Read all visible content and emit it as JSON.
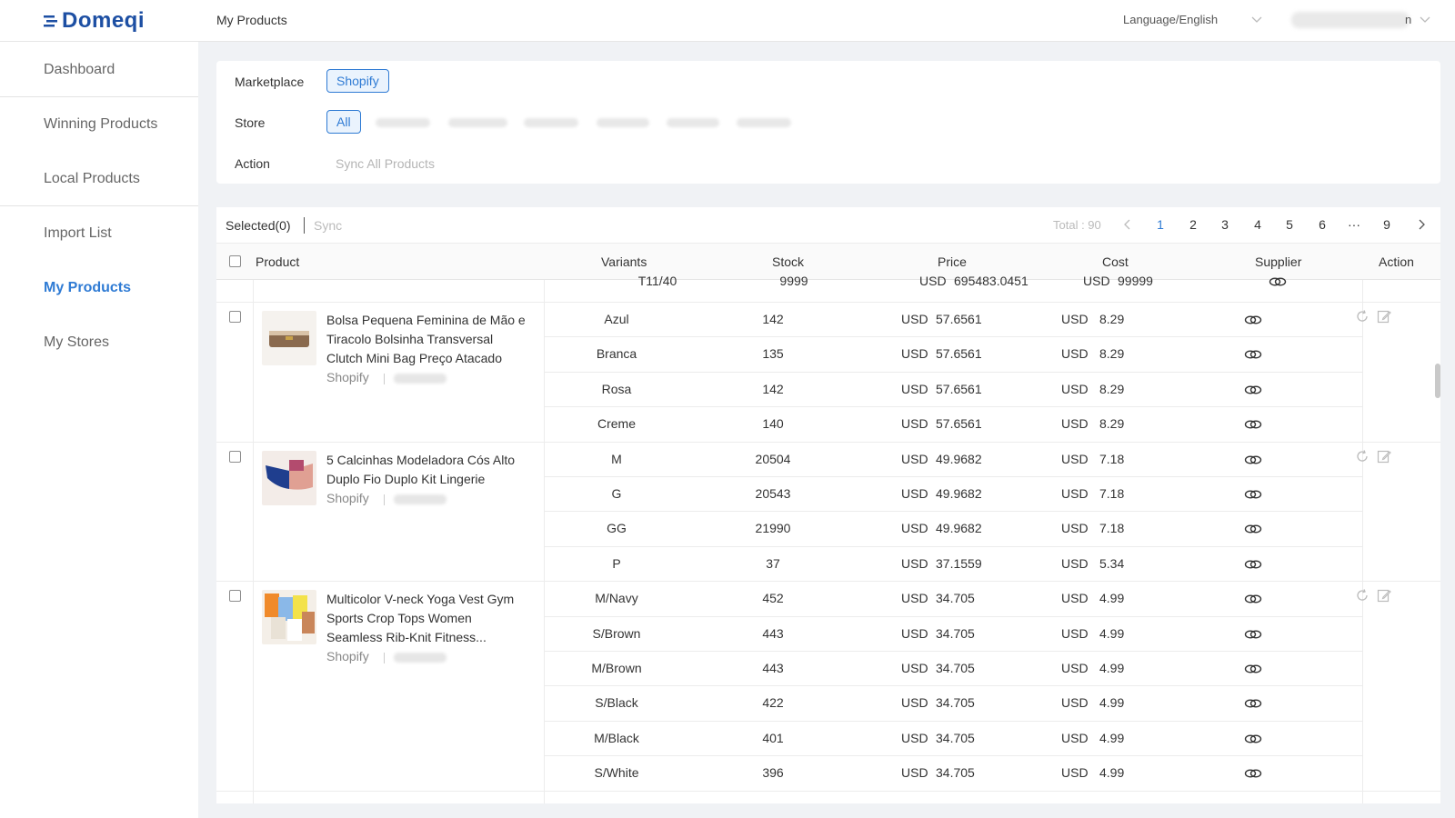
{
  "app": {
    "logo_text": "Domeqi",
    "page_title": "My Products"
  },
  "header": {
    "language": "Language/English",
    "user_suffix": "n"
  },
  "sidebar": {
    "items": [
      {
        "label": "Dashboard"
      },
      {
        "label": "Winning Products"
      },
      {
        "label": "Local Products"
      },
      {
        "label": "Import List"
      },
      {
        "label": "My Products"
      },
      {
        "label": "My Stores"
      }
    ]
  },
  "filters": {
    "marketplace_label": "Marketplace",
    "marketplace_value": "Shopify",
    "store_label": "Store",
    "store_selected": "All",
    "action_label": "Action",
    "action_link": "Sync All Products"
  },
  "toolbar": {
    "selected": "Selected(0)",
    "sync": "Sync",
    "total": "Total : 90",
    "pages": [
      "1",
      "2",
      "3",
      "4",
      "5",
      "6",
      "···",
      "9"
    ],
    "current_page": "1"
  },
  "table": {
    "headers": {
      "product": "Product",
      "variants": "Variants",
      "stock": "Stock",
      "price": "Price",
      "cost": "Cost",
      "supplier": "Supplier",
      "action": "Action"
    },
    "partial_row": {
      "variant": "T11/40",
      "stock": "9999",
      "price_cur": "USD",
      "price": "695483.0451",
      "cost_cur": "USD",
      "cost": "99999"
    },
    "products": [
      {
        "title": "Bolsa Pequena Feminina de Mão e Tiracolo Bolsinha Transversal Clutch Mini Bag Preço Atacado",
        "platform": "Shopify",
        "variants": [
          {
            "name": "Azul",
            "stock": "142",
            "price_cur": "USD",
            "price": "57.6561",
            "cost_cur": "USD",
            "cost": "8.29"
          },
          {
            "name": "Branca",
            "stock": "135",
            "price_cur": "USD",
            "price": "57.6561",
            "cost_cur": "USD",
            "cost": "8.29"
          },
          {
            "name": "Rosa",
            "stock": "142",
            "price_cur": "USD",
            "price": "57.6561",
            "cost_cur": "USD",
            "cost": "8.29"
          },
          {
            "name": "Creme",
            "stock": "140",
            "price_cur": "USD",
            "price": "57.6561",
            "cost_cur": "USD",
            "cost": "8.29"
          }
        ]
      },
      {
        "title": "5 Calcinhas Modeladora Cós Alto Duplo Fio Duplo Kit Lingerie",
        "platform": "Shopify",
        "variants": [
          {
            "name": "M",
            "stock": "20504",
            "price_cur": "USD",
            "price": "49.9682",
            "cost_cur": "USD",
            "cost": "7.18"
          },
          {
            "name": "G",
            "stock": "20543",
            "price_cur": "USD",
            "price": "49.9682",
            "cost_cur": "USD",
            "cost": "7.18"
          },
          {
            "name": "GG",
            "stock": "21990",
            "price_cur": "USD",
            "price": "49.9682",
            "cost_cur": "USD",
            "cost": "7.18"
          },
          {
            "name": "P",
            "stock": "37",
            "price_cur": "USD",
            "price": "37.1559",
            "cost_cur": "USD",
            "cost": "5.34"
          }
        ]
      },
      {
        "title": "Multicolor V-neck Yoga Vest Gym Sports Crop Tops Women Seamless Rib-Knit Fitness...",
        "platform": "Shopify",
        "variants": [
          {
            "name": "M/Navy",
            "stock": "452",
            "price_cur": "USD",
            "price": "34.705",
            "cost_cur": "USD",
            "cost": "4.99"
          },
          {
            "name": "S/Brown",
            "stock": "443",
            "price_cur": "USD",
            "price": "34.705",
            "cost_cur": "USD",
            "cost": "4.99"
          },
          {
            "name": "M/Brown",
            "stock": "443",
            "price_cur": "USD",
            "price": "34.705",
            "cost_cur": "USD",
            "cost": "4.99"
          },
          {
            "name": "S/Black",
            "stock": "422",
            "price_cur": "USD",
            "price": "34.705",
            "cost_cur": "USD",
            "cost": "4.99"
          },
          {
            "name": "M/Black",
            "stock": "401",
            "price_cur": "USD",
            "price": "34.705",
            "cost_cur": "USD",
            "cost": "4.99"
          },
          {
            "name": "S/White",
            "stock": "396",
            "price_cur": "USD",
            "price": "34.705",
            "cost_cur": "USD",
            "cost": "4.99"
          }
        ]
      }
    ]
  },
  "icons": {
    "supplier": "link-icon",
    "refresh": "refresh-icon",
    "edit": "edit-icon"
  },
  "colors": {
    "accent": "#2f7bd4",
    "brand": "#1d4fa3",
    "muted": "#b5b5b5"
  }
}
